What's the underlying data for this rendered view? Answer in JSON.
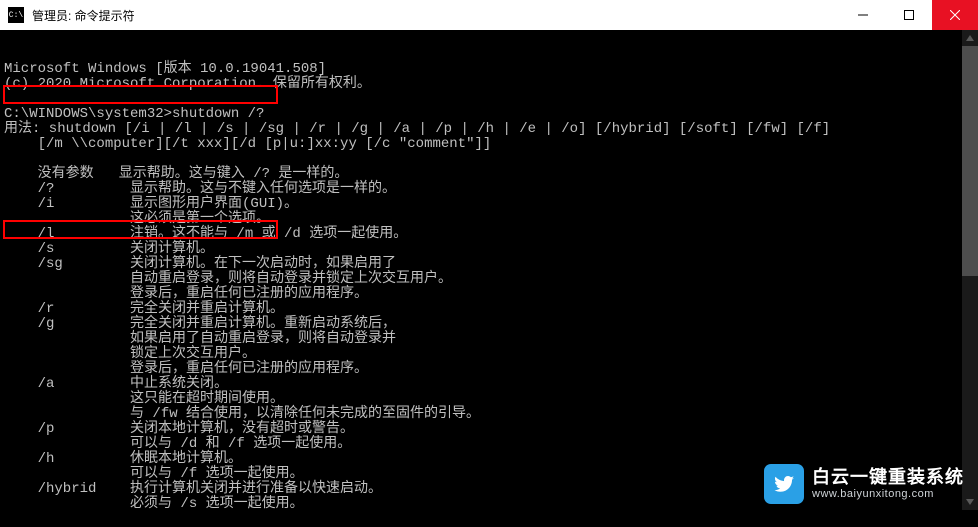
{
  "titlebar": {
    "icon_label": "C:\\",
    "title": "管理员: 命令提示符"
  },
  "window_controls": {
    "minimize": "minimize",
    "maximize": "maximize",
    "close": "close"
  },
  "terminal": {
    "header1": "Microsoft Windows [版本 10.0.19041.508]",
    "header2": "(c) 2020 Microsoft Corporation. 保留所有权利。",
    "prompt": "C:\\WINDOWS\\system32>",
    "command": "shutdown /?",
    "usage_label": "用法:",
    "usage_line1": "shutdown [/i | /l | /s | /sg | /r | /g | /a | /p | /h | /e | /o] [/hybrid] [/soft] [/fw] [/f]",
    "usage_line2": "[/m \\\\computer][/t xxx][/d [p|u:]xx:yy [/c \"comment\"]]",
    "options": [
      {
        "flag": "没有参数",
        "desc": [
          "显示帮助。这与键入 /? 是一样的。"
        ]
      },
      {
        "flag": "/?",
        "desc": [
          "显示帮助。这与不键入任何选项是一样的。"
        ]
      },
      {
        "flag": "/i",
        "desc": [
          "显示图形用户界面(GUI)。",
          "这必须是第一个选项。"
        ]
      },
      {
        "flag": "/l",
        "desc": [
          "注销。这不能与 /m 或 /d 选项一起使用。"
        ]
      },
      {
        "flag": "/s",
        "desc": [
          "关闭计算机。"
        ]
      },
      {
        "flag": "/sg",
        "desc": [
          "关闭计算机。在下一次启动时，如果启用了",
          "自动重启登录，则将自动登录并锁定上次交互用户。",
          "登录后，重启任何已注册的应用程序。"
        ]
      },
      {
        "flag": "/r",
        "desc": [
          "完全关闭并重启计算机。"
        ]
      },
      {
        "flag": "/g",
        "desc": [
          "完全关闭并重启计算机。重新启动系统后，",
          "如果启用了自动重启登录，则将自动登录并",
          "锁定上次交互用户。",
          "登录后，重启任何已注册的应用程序。"
        ]
      },
      {
        "flag": "/a",
        "desc": [
          "中止系统关闭。",
          "这只能在超时期间使用。",
          "与 /fw 结合使用，以清除任何未完成的至固件的引导。"
        ]
      },
      {
        "flag": "/p",
        "desc": [
          "关闭本地计算机，没有超时或警告。",
          "可以与 /d 和 /f 选项一起使用。"
        ]
      },
      {
        "flag": "/h",
        "desc": [
          "休眠本地计算机。",
          "可以与 /f 选项一起使用。"
        ]
      },
      {
        "flag": "/hybrid",
        "desc": [
          "执行计算机关闭并进行准备以快速启动。",
          "必须与 /s 选项一起使用。"
        ]
      }
    ]
  },
  "watermark": {
    "main": "白云一键重装系统",
    "sub": "www.baiyunxitong.com"
  },
  "colors": {
    "titlebar_bg": "#ffffff",
    "close_bg": "#e81123",
    "term_bg": "#000000",
    "term_fg": "#c0c0c0",
    "highlight": "#ff0000",
    "wm_logo": "#2aa0e6"
  }
}
